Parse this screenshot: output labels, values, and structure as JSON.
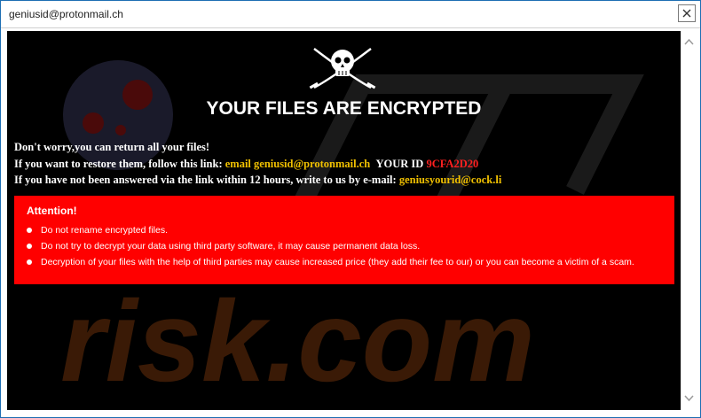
{
  "window": {
    "title": "geniusid@protonmail.ch"
  },
  "icons": {
    "close": "close-icon",
    "logo": "pirate-skull-crossed-swords-icon",
    "scroll_up": "chevron-up-icon",
    "scroll_down": "chevron-down-icon"
  },
  "colors": {
    "background": "#000000",
    "accent_yellow": "#f0c000",
    "accent_red": "#ff2020",
    "alert_box": "#ff0000"
  },
  "note": {
    "headline": "YOUR FILES ARE ENCRYPTED",
    "line1": "Don't worry,you can return all your files!",
    "line2_prefix": "If you want to restore them, follow this link: ",
    "line2_email": "email geniusid@protonmail.ch",
    "line2_id_label": "YOUR ID ",
    "line2_id_value": "9CFA2D20",
    "line3_prefix": "If you have not been answered via the link within 12 hours, write to us by e-mail: ",
    "line3_email": "geniusyourid@cock.li"
  },
  "attention": {
    "title": "Attention!",
    "items": [
      "Do not rename encrypted files.",
      "Do not try to decrypt your data using third party software, it may cause permanent data loss.",
      "Decryption of your files with the help of third parties may cause increased price (they add their fee to our) or you can become a victim of a scam."
    ]
  },
  "watermark": {
    "text": "risk.com"
  }
}
